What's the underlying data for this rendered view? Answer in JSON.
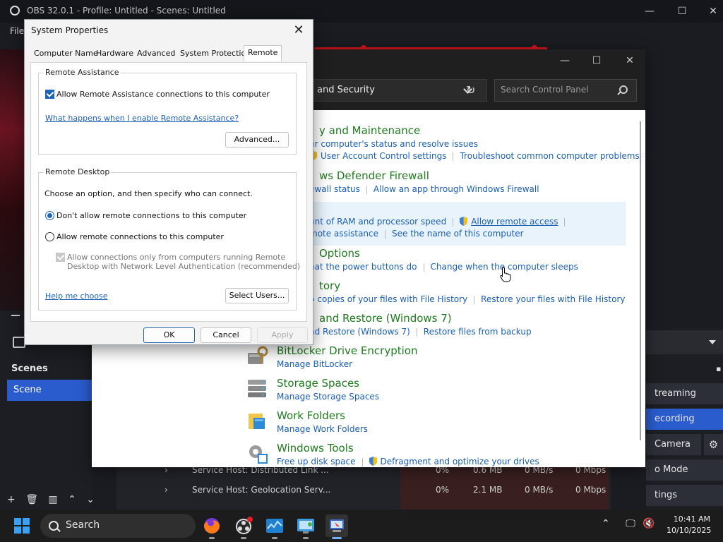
{
  "obs": {
    "title": "OBS 32.0.1 - Profile: Untitled - Scenes: Untitled",
    "menu_first": "File",
    "scenes_header": "Scenes",
    "scene_item": "Scene",
    "controls": [
      "treaming",
      "ecording",
      "Camera",
      "o Mode",
      "tings"
    ],
    "processes": [
      {
        "name": "Service Host: Distributed Link ...",
        "cpu": "0%",
        "mem": "0.6 MB",
        "disk": "0 MB/s",
        "net": "0 Mbps"
      },
      {
        "name": "Service Host: Geolocation Serv...",
        "cpu": "0%",
        "mem": "2.1 MB",
        "disk": "0 MB/s",
        "net": "0 Mbps"
      }
    ]
  },
  "control_panel": {
    "address": "and Security",
    "search_placeholder": "Search Control Panel",
    "categories": [
      {
        "title": "y and Maintenance",
        "links": [
          "ur computer's status and resolve issues"
        ],
        "links2": [
          "User Account Control settings",
          "Troubleshoot common computer problems"
        ]
      },
      {
        "title": "ws Defender Firewall",
        "links": [
          "ewall status",
          "Allow an app through Windows Firewall"
        ]
      },
      {
        "title": "",
        "links": [
          "unt of RAM and processor speed",
          "Allow remote access"
        ],
        "links2": [
          "mote assistance",
          "See the name of this computer"
        ]
      },
      {
        "title": "Options",
        "links": [
          "hat the power buttons do",
          "Change when the computer sleeps"
        ]
      },
      {
        "title": "tory",
        "links": [
          "p copies of your files with File History",
          "Restore your files with File History"
        ]
      },
      {
        "title": "and Restore (Windows 7)",
        "links": [
          "nd Restore (Windows 7)",
          "Restore files from backup"
        ]
      },
      {
        "title": "BitLocker Drive Encryption",
        "links": [
          "Manage BitLocker"
        ]
      },
      {
        "title": "Storage Spaces",
        "links": [
          "Manage Storage Spaces"
        ]
      },
      {
        "title": "Work Folders",
        "links": [
          "Manage Work Folders"
        ]
      },
      {
        "title": "Windows Tools",
        "links": [
          "Free up disk space",
          "Defragment and optimize your drives"
        ]
      }
    ]
  },
  "system_properties": {
    "title": "System Properties",
    "tabs": [
      "Computer Name",
      "Hardware",
      "Advanced",
      "System Protection",
      "Remote"
    ],
    "remote_assistance": {
      "group": "Remote Assistance",
      "allow_label": "Allow Remote Assistance connections to this computer",
      "allow_checked": true,
      "help_link": "What happens when I enable Remote Assistance?",
      "advanced_button": "Advanced..."
    },
    "remote_desktop": {
      "group": "Remote Desktop",
      "instruction": "Choose an option, and then specify who can connect.",
      "option_dont": "Don't allow remote connections to this computer",
      "option_allow": "Allow remote connections to this computer",
      "selected": "dont",
      "nla_line1": "Allow connections only from computers running Remote",
      "nla_line2": "Desktop with Network Level Authentication (recommended)",
      "help_link": "Help me choose",
      "select_users_button": "Select Users..."
    },
    "ok": "OK",
    "cancel": "Cancel",
    "apply": "Apply"
  },
  "taskbar": {
    "search": "Search",
    "time": "10:41 AM",
    "date": "10/10/2025"
  },
  "colors": {
    "accent": "#1f65b5",
    "cp_category": "#1e7b1e",
    "link": "#1a5fb4",
    "obs_record": "#d3141c"
  }
}
